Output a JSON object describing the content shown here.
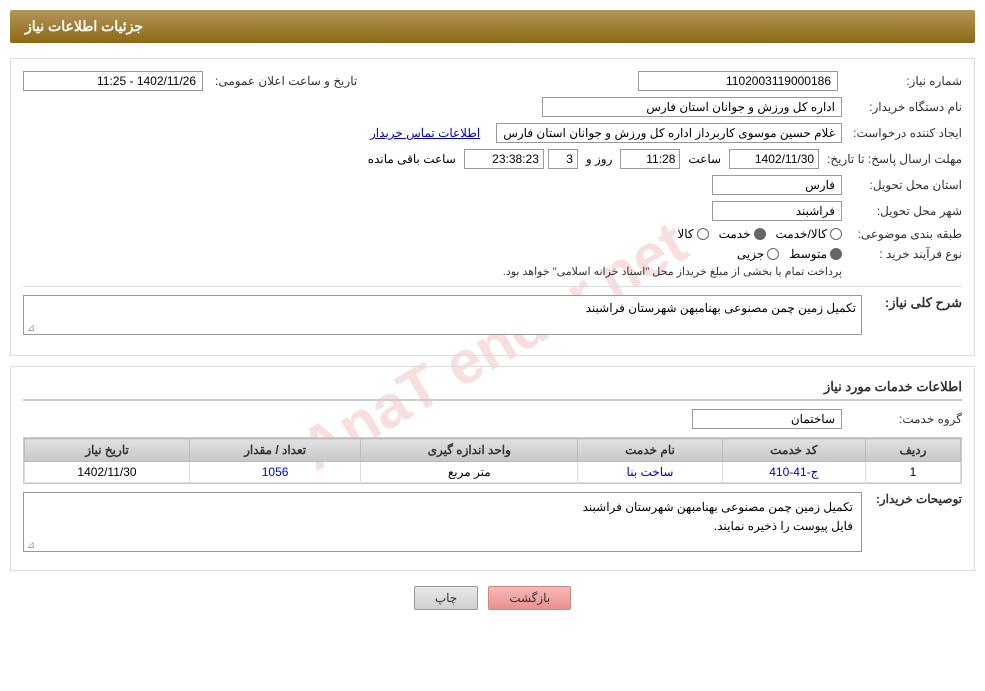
{
  "header": {
    "title": "جزئیات اطلاعات نیاز"
  },
  "fields": {
    "need_number_label": "شماره نیاز:",
    "need_number_value": "1102003119000186",
    "date_time_label": "تاریخ و ساعت اعلان عمومی:",
    "date_time_value": "1402/11/26 - 11:25",
    "buyer_dept_label": "نام دستگاه خریدار:",
    "buyer_dept_value": "اداره کل ورزش و جوانان استان فارس",
    "creator_label": "ایجاد کننده درخواست:",
    "creator_value": "غلام حسین موسوی کاربرداز اداره کل ورزش و جوانان استان فارس",
    "contact_link": "اطلاعات تماس خریدار",
    "deadline_label": "مهلت ارسال پاسخ: تا تاریخ:",
    "deadline_date": "1402/11/30",
    "deadline_time_label": "ساعت",
    "deadline_time": "11:28",
    "deadline_days_label": "روز و",
    "deadline_days": "3",
    "deadline_remaining_label": "ساعت باقی مانده",
    "deadline_remaining": "23:38:23",
    "province_label": "استان محل تحویل:",
    "province_value": "فارس",
    "city_label": "شهر محل تحویل:",
    "city_value": "فراشبند",
    "category_label": "طبقه بندی موضوعی:",
    "category_goods": "کالا",
    "category_service": "خدمت",
    "category_goods_service": "کالا/خدمت",
    "category_selected": "خدمت",
    "purchase_type_label": "نوع فرآیند خرید :",
    "purchase_partial": "جزیی",
    "purchase_medium": "متوسط",
    "purchase_note": "پرداخت تمام یا بخشی از مبلغ خریداز محل \"اسناد خزانه اسلامی\" خواهد بود.",
    "need_description_label": "شرح کلی نیاز:",
    "need_description_value": "تکمیل زمین چمن مصنوعی بهنامبهن شهرستان فراشبند",
    "services_section_title": "اطلاعات خدمات مورد نیاز",
    "service_group_label": "گروه خدمت:",
    "service_group_value": "ساختمان",
    "table_headers": {
      "row_num": "ردیف",
      "service_code": "کد خدمت",
      "service_name": "نام خدمت",
      "unit": "واحد اندازه گیری",
      "qty": "تعداد / مقدار",
      "need_date": "تاریخ نیاز"
    },
    "table_rows": [
      {
        "row_num": "1",
        "service_code": "ج-41-410",
        "service_name": "ساخت بنا",
        "unit": "متر مربع",
        "qty": "1056",
        "need_date": "1402/11/30"
      }
    ],
    "buyer_notes_label": "توصیحات خریدار:",
    "buyer_notes_value": "تکمیل زمین چمن مصنوعی بهنامبهن شهرستان فراشبند\nفایل پیوست را ذخیره نمایند."
  },
  "buttons": {
    "print_label": "چاپ",
    "back_label": "بازگشت"
  }
}
